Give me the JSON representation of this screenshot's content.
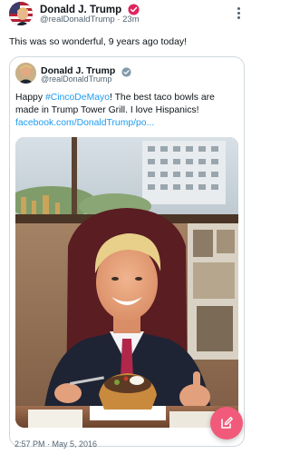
{
  "author": {
    "name": "Donald J. Trump",
    "handle": "@realDonaldTrump",
    "separator": "·",
    "age": "23m"
  },
  "tweet": {
    "text": "This was so wonderful, 9 years ago today!"
  },
  "quoted": {
    "name": "Donald J. Trump",
    "handle": "@realDonaldTrump",
    "text_before": "Happy ",
    "hashtag": "#CincoDeMayo",
    "text_after": "! The best taco bowls are made in Trump Tower Grill. I love Hispanics!",
    "link": "facebook.com/DonaldTrump/po...",
    "photo_icon": "photo-of-man-with-taco-bowl",
    "timestamp": "2:57 PM · May 5, 2016"
  },
  "icons": {
    "verified": "verified-badge-icon",
    "more": "more-options-icon",
    "compose": "compose-icon"
  },
  "colors": {
    "link": "#1d9bf0",
    "verified_main": "#e0245e",
    "verified_quote": "#829aab",
    "fab": "#f15a7a",
    "secondary_text": "#536471"
  }
}
